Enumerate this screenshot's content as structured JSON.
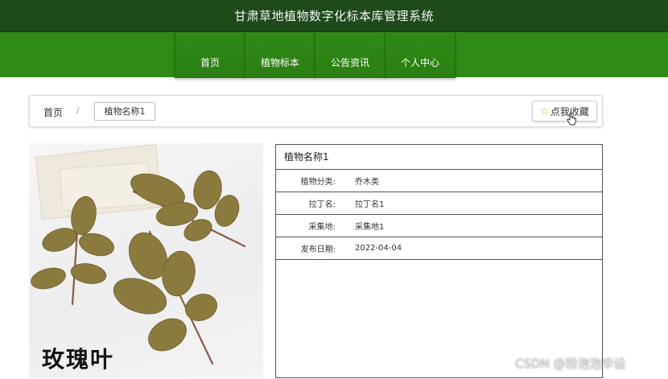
{
  "header": {
    "title": "甘肃草地植物数字化标本库管理系统"
  },
  "nav": {
    "items": [
      {
        "label": "首页"
      },
      {
        "label": "植物标本"
      },
      {
        "label": "公告资讯"
      },
      {
        "label": "个人中心"
      }
    ]
  },
  "breadcrumb": {
    "home": "首页",
    "separator": "/",
    "current": "植物名称1"
  },
  "favorite": {
    "label": "点我收藏",
    "icon": "star-icon"
  },
  "photo": {
    "caption": "玫瑰叶"
  },
  "detail": {
    "title": "植物名称1",
    "rows": [
      {
        "label": "植物分类:",
        "value": "乔木类"
      },
      {
        "label": "拉丁名:",
        "value": "拉丁名1"
      },
      {
        "label": "采集地:",
        "value": "采集地1"
      },
      {
        "label": "发布日期:",
        "value": "2022-04-04"
      }
    ]
  },
  "watermark": "CSDN @粉泡泡毕设",
  "colors": {
    "header_bg": "#1f4a1c",
    "nav_bg": "#2f8a16",
    "star": "#e4b400"
  }
}
